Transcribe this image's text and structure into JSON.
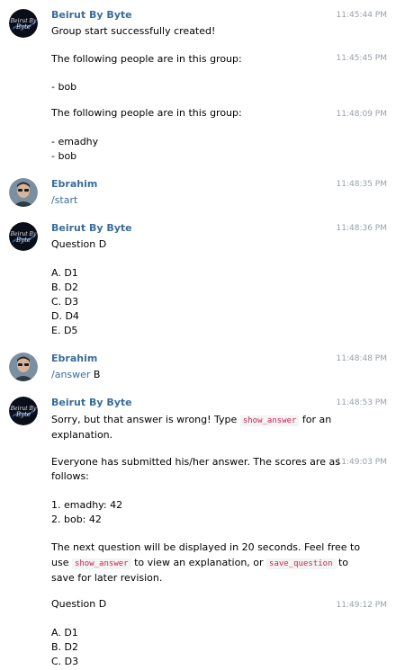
{
  "bot": {
    "name": "Beirut By Byte",
    "avatar_text": "Beirut By Byte"
  },
  "user": {
    "name": "Ebrahim"
  },
  "group1": {
    "t1": "11:45:44 PM",
    "l1": "Group start successfully created!",
    "t2": "11:45:45 PM",
    "l2": "The following people are in this group:",
    "l3": "- bob",
    "t3": "11:48:09 PM",
    "l4": "The following people are in this group:",
    "l5": "- emadhy",
    "l6": "- bob"
  },
  "group2": {
    "t1": "11:48:35 PM",
    "cmd": "/start"
  },
  "group3": {
    "t1": "11:48:36 PM",
    "l1": "Question D",
    "l2": "A. D1",
    "l3": "B. D2",
    "l4": "C. D3",
    "l5": "D. D4",
    "l6": "E. D5"
  },
  "group4": {
    "t1": "11:48:48 PM",
    "cmd": "/answer",
    "arg": " B"
  },
  "group5": {
    "t1": "11:48:53 PM",
    "l1a": "Sorry, but that answer is wrong! Type ",
    "l1code": "show_answer",
    "l1b": " for an",
    "l2": "explanation.",
    "t2": "11:49:03 PM",
    "l3": "Everyone has submitted his/her answer. The scores are as",
    "l4": "follows:",
    "l5": "1. emadhy: 42",
    "l6": "2. bob: 42",
    "l7": "The next question will be displayed in 20 seconds. Feel free to",
    "l8a": "use ",
    "l8code1": "show_answer",
    "l8b": " to view an explanation, or ",
    "l8code2": "save_question",
    "l8c": " to",
    "l9": "save for later revision.",
    "t3": "11:49:12 PM",
    "l10": "Question D",
    "l11": "A. D1",
    "l12": "B. D2",
    "l13": "C. D3"
  }
}
